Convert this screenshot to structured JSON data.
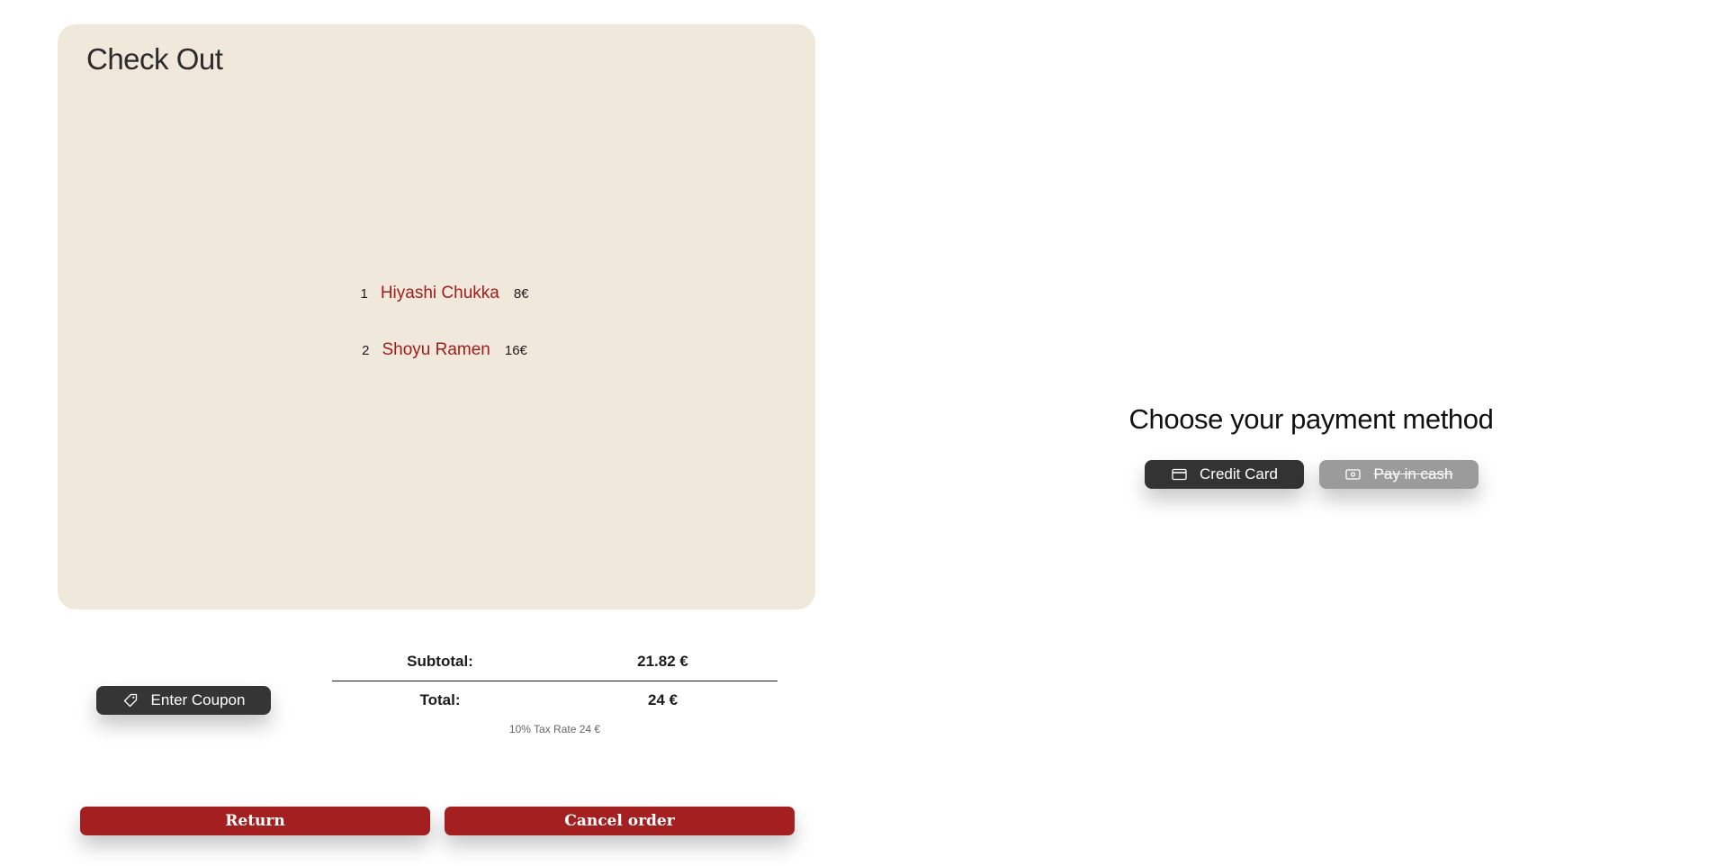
{
  "checkout": {
    "title": "Check Out",
    "items": [
      {
        "qty": "1",
        "name": "Hiyashi Chukka",
        "price": "8€"
      },
      {
        "qty": "2",
        "name": "Shoyu Ramen",
        "price": "16€"
      }
    ]
  },
  "coupon": {
    "label": "Enter Coupon",
    "icon": "tag-icon"
  },
  "totals": {
    "subtotal_label": "Subtotal:",
    "subtotal_value": "21.82 €",
    "total_label": "Total:",
    "total_value": "24 €",
    "tax_note": "10% Tax Rate 24 €"
  },
  "actions": {
    "return_label": "Return",
    "cancel_label": "Cancel order"
  },
  "payment": {
    "title": "Choose your payment method",
    "credit_card_label": "Credit Card",
    "credit_card_icon": "credit-card-icon",
    "cash_label": "Pay in cash",
    "cash_icon": "cash-icon"
  },
  "colors": {
    "card_background": "#f1e8dc",
    "item_name": "#9e1c1c",
    "primary_action": "#a41f1f",
    "dark_button": "#333333",
    "disabled_button": "#9b9b9b"
  }
}
